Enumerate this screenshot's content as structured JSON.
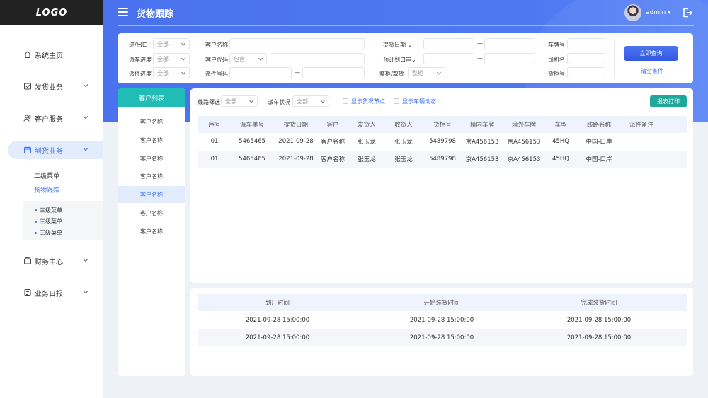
{
  "app": {
    "logo": "LOGO",
    "page_title": "货物跟踪",
    "user": "admin"
  },
  "sidebar": {
    "items": [
      {
        "label": "系统主页"
      },
      {
        "label": "发货业务"
      },
      {
        "label": "客户服务"
      },
      {
        "label": "到货业务"
      },
      {
        "label": "财务中心"
      },
      {
        "label": "业务日报"
      }
    ],
    "sub": [
      "二级菜单",
      "货物跟踪"
    ],
    "sub3": [
      "三级菜单",
      "三级菜单",
      "三级菜单"
    ]
  },
  "filters": {
    "io_label": "进/出口",
    "io_value": "全部",
    "dispatch_progress_label": "派车进度",
    "dispatch_progress_value": "全部",
    "pickup_progress_label": "派件进度",
    "pickup_progress_value": "全部",
    "customer_name_label": "客户名称",
    "customer_code_label": "客户代码",
    "customer_code_mode": "包含",
    "pickup_no_label": "派件号码",
    "pickup_date_label": "提货日期",
    "eta_label": "预计到口岸",
    "container_label": "整柜/散货",
    "container_value": "整柜",
    "plate_label": "车牌号",
    "driver_label": "司机名",
    "cargo_no_label": "货柜号",
    "dash": "—",
    "query_button": "立即查询",
    "clear_link": "清空条件"
  },
  "customer_list": {
    "title": "客户列表",
    "items": [
      "客户名称",
      "客户名称",
      "客户名称",
      "客户名称",
      "客户名称",
      "客户名称",
      "客户名称"
    ],
    "selected_index": 4
  },
  "main_table": {
    "route_filter_label": "线路筛选",
    "route_filter_value": "全部",
    "dispatch_status_label": "派车状况",
    "dispatch_status_value": "全部",
    "check_nodes_label": "显示货况节点",
    "check_vehicle_label": "显示车辆动态",
    "print_button": "报表打印",
    "columns": [
      "序号",
      "派车单号",
      "提货日期",
      "客户",
      "发货人",
      "收货人",
      "货柜号",
      "境内车牌",
      "境外车牌",
      "车型",
      "线路名称",
      "派件备注"
    ],
    "rows": [
      [
        "01",
        "5465465",
        "2021-09-28",
        "客户名称",
        "张玉龙",
        "张玉龙",
        "5489798",
        "京A456153",
        "京A456153",
        "45HQ",
        "中国-口岸",
        ""
      ],
      [
        "01",
        "5465465",
        "2021-09-28",
        "客户名称",
        "张玉龙",
        "张玉龙",
        "5489798",
        "京A456153",
        "京A456153",
        "45HQ",
        "中国-口岸",
        ""
      ]
    ]
  },
  "time_table": {
    "columns": [
      "到厂时间",
      "开始装货时间",
      "完成装货时间"
    ],
    "rows": [
      [
        "2021-09-28  15:00:00",
        "2021-09-28  15:00:00",
        "2021-09-28  15:00:00"
      ],
      [
        "2021-09-28  15:00:00",
        "2021-09-28  15:00:00",
        "2021-09-28  15:00:00"
      ]
    ]
  }
}
